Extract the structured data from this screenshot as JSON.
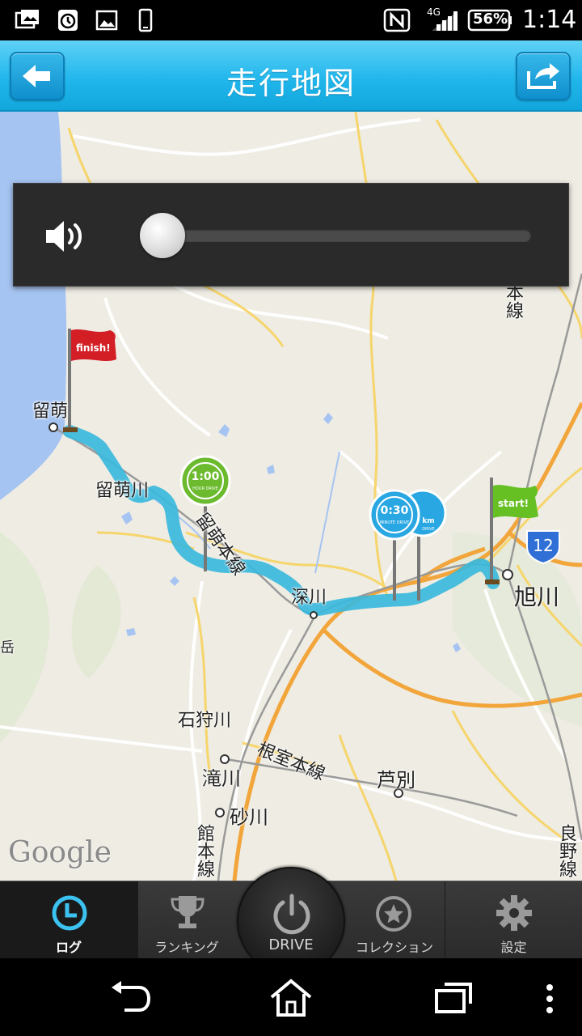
{
  "status_bar": {
    "network": "4G",
    "battery": "56%",
    "time": "1:14"
  },
  "header": {
    "title": "走行地図",
    "back_icon": "back-arrow-icon",
    "share_icon": "share-icon"
  },
  "volume": {
    "icon": "speaker-icon",
    "level": 0
  },
  "map": {
    "labels": {
      "rumoi": "留萌",
      "rumoi_river": "留萌川",
      "rumoi_main_line": "留萌本線",
      "asahikawa": "旭川",
      "fukagawa_partial": "深川",
      "ishikari_river": "石狩川",
      "nemuro_main_line": "根室本線",
      "takikawa": "滝川",
      "ashibetsu": "芦別",
      "sunagawa": "砂川",
      "hakodate_main_line_partial": "館本線",
      "furano_line_partial": "良野線",
      "line_partial": "本線",
      "dake_partial": "岳",
      "route_12": "12"
    },
    "markers": {
      "finish_flag": "finish!",
      "start_flag": "start!",
      "badge_1h": {
        "time": "1:00",
        "text": "HOUR DRIVE"
      },
      "badge_30m": {
        "time": "0:30",
        "text": "MINUTE DRIVE"
      },
      "badge_km": {
        "time": "km",
        "text": "DRIVE"
      }
    },
    "attribution": "Google"
  },
  "tabs": [
    {
      "label": "ログ",
      "icon": "clock-icon",
      "active": true
    },
    {
      "label": "ランキング",
      "icon": "trophy-icon",
      "active": false
    },
    {
      "label": "DRIVE",
      "icon": "power-icon",
      "active": false
    },
    {
      "label": "コレクション",
      "icon": "star-icon",
      "active": false
    },
    {
      "label": "設定",
      "icon": "gear-icon",
      "active": false
    }
  ],
  "colors": {
    "header": "#22b7ec",
    "route": "#3bb8dc",
    "active_tab_icon": "#3cc2f0"
  }
}
